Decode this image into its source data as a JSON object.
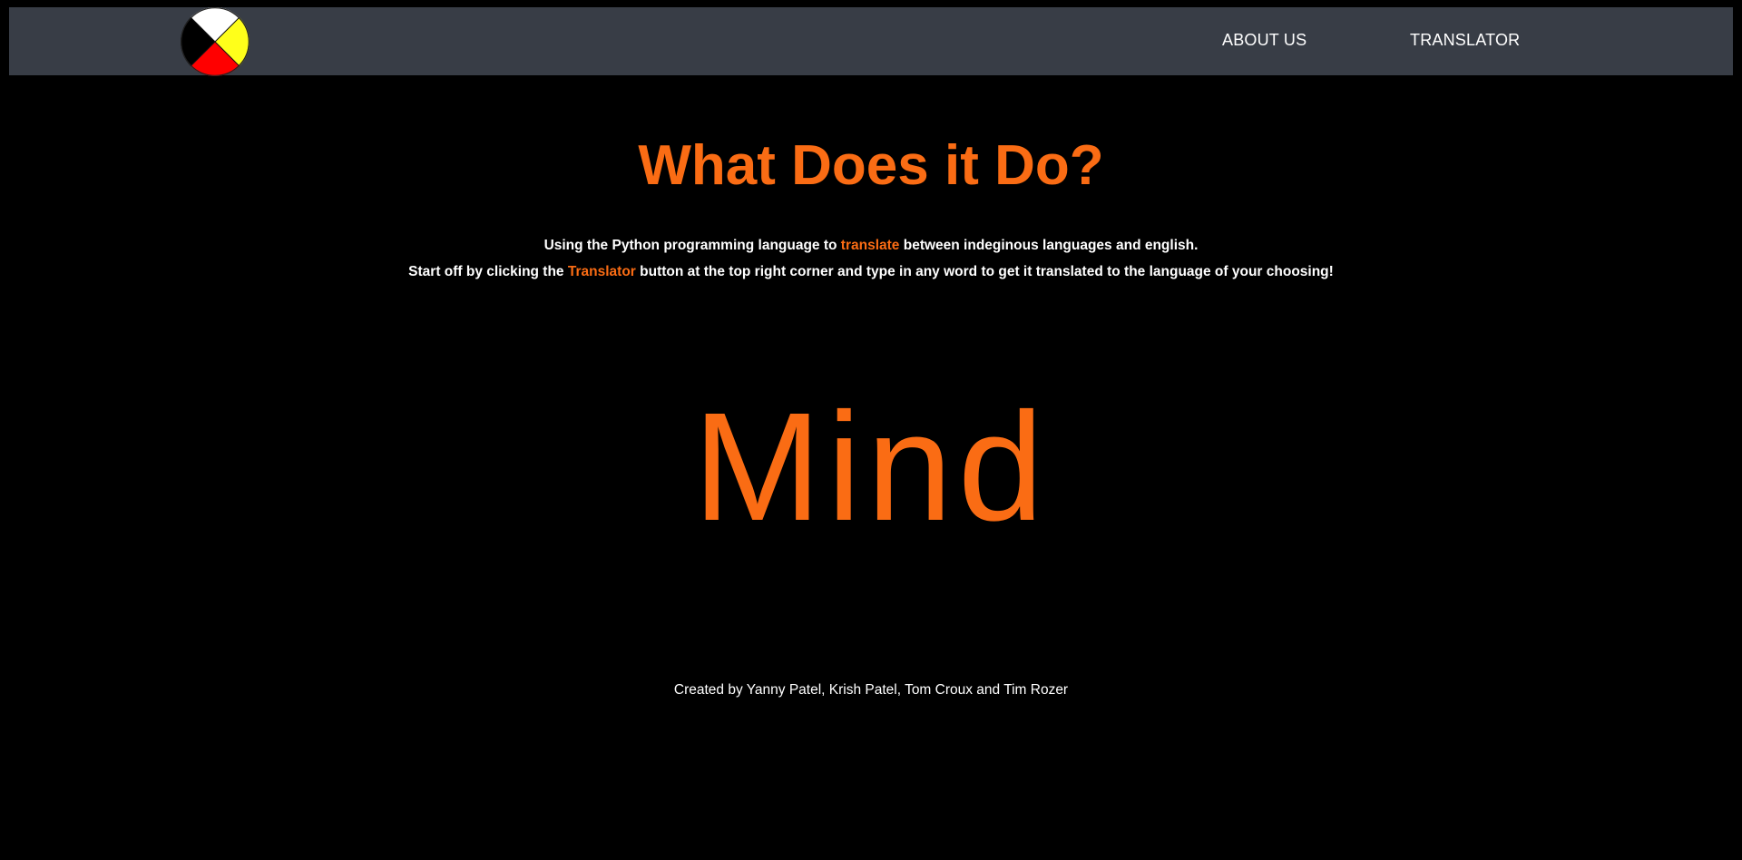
{
  "colors": {
    "background": "#000000",
    "navbar": "#383d46",
    "accent": "#fa6c14",
    "text": "#ffffff",
    "logo_quadrants": [
      "#ffffff",
      "#ffff1a",
      "#ff0000",
      "#000000"
    ]
  },
  "nav": {
    "logo_icon": "medicine-wheel-icon",
    "links": [
      {
        "label": "ABOUT US"
      },
      {
        "label": "TRANSLATOR"
      }
    ]
  },
  "main": {
    "title": "What Does it Do?",
    "line1": {
      "before": "Using the Python programming language to ",
      "highlight": "translate",
      "after": " between indeginous languages and english."
    },
    "line2": {
      "before": "Start off by clicking the ",
      "highlight": "Translator",
      "after": " button at the top right corner and type in any word to get it translated to the language of your choosing!"
    },
    "word": "Mind"
  },
  "footer": {
    "credit": "Created by Yanny Patel, Krish Patel, Tom Croux and Tim Rozer"
  }
}
